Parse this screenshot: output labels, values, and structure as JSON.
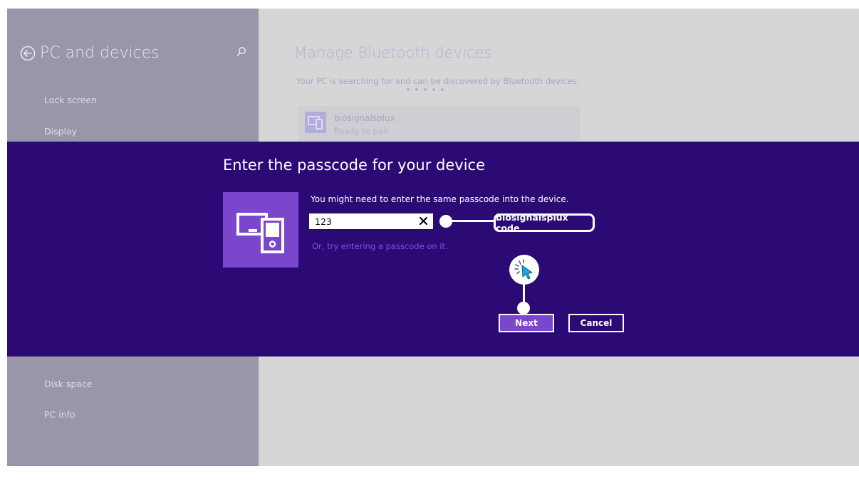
{
  "sidebar": {
    "title": "PC and devices",
    "items_top": [
      {
        "label": "Lock screen"
      },
      {
        "label": "Display"
      }
    ],
    "items_bottom": [
      {
        "label": "Disk space"
      },
      {
        "label": "PC info"
      }
    ],
    "icons": {
      "back": "back-arrow-circle-icon",
      "search": "search-icon"
    }
  },
  "content": {
    "title": "Manage Bluetooth devices",
    "status": "Your PC is searching for and can be discovered by Bluetooth devices.",
    "device": {
      "name": "biosignalsplux",
      "status": "Ready to pair"
    }
  },
  "dialog": {
    "title": "Enter the passcode for your device",
    "instruction": "You might need to enter the same passcode into the device.",
    "passcode_value": "123",
    "alt_link": "Or, try entering a passcode on it.",
    "next_label": "Next",
    "cancel_label": "Cancel"
  },
  "annotation": {
    "label": "biosignalsplux code"
  },
  "colors": {
    "dialog_bg": "#2b0a75",
    "accent": "#7a47cc",
    "sidebar_bg": "#9a96aa",
    "content_bg": "#d6d6d6",
    "link": "#7d52e2"
  }
}
